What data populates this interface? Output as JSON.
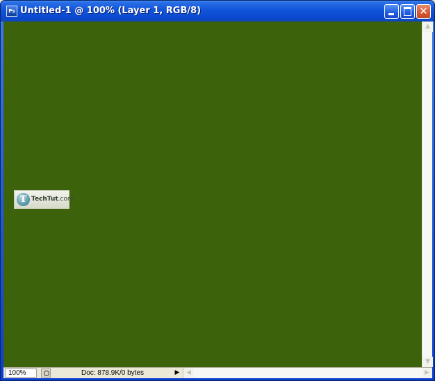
{
  "window": {
    "title": "Untitled-1 @ 100% (Layer 1, RGB/8)",
    "app_icon": "photoshop-icon",
    "app_icon_text": "Ps"
  },
  "caption_buttons": {
    "minimize": "minimize-icon",
    "maximize": "maximize-icon",
    "close": "close-icon",
    "close_glyph": "✕"
  },
  "canvas": {
    "fill_color": "#3D620C"
  },
  "watermark": {
    "letter": "T",
    "name": "TechTut",
    "domain": ".com"
  },
  "statusbar": {
    "zoom": "100%",
    "doc_info": "Doc: 878.9K/0 bytes",
    "menu_arrow": "▶"
  },
  "scrollbars": {
    "up": "▲",
    "down": "▼",
    "left": "◀",
    "right": "▶"
  }
}
